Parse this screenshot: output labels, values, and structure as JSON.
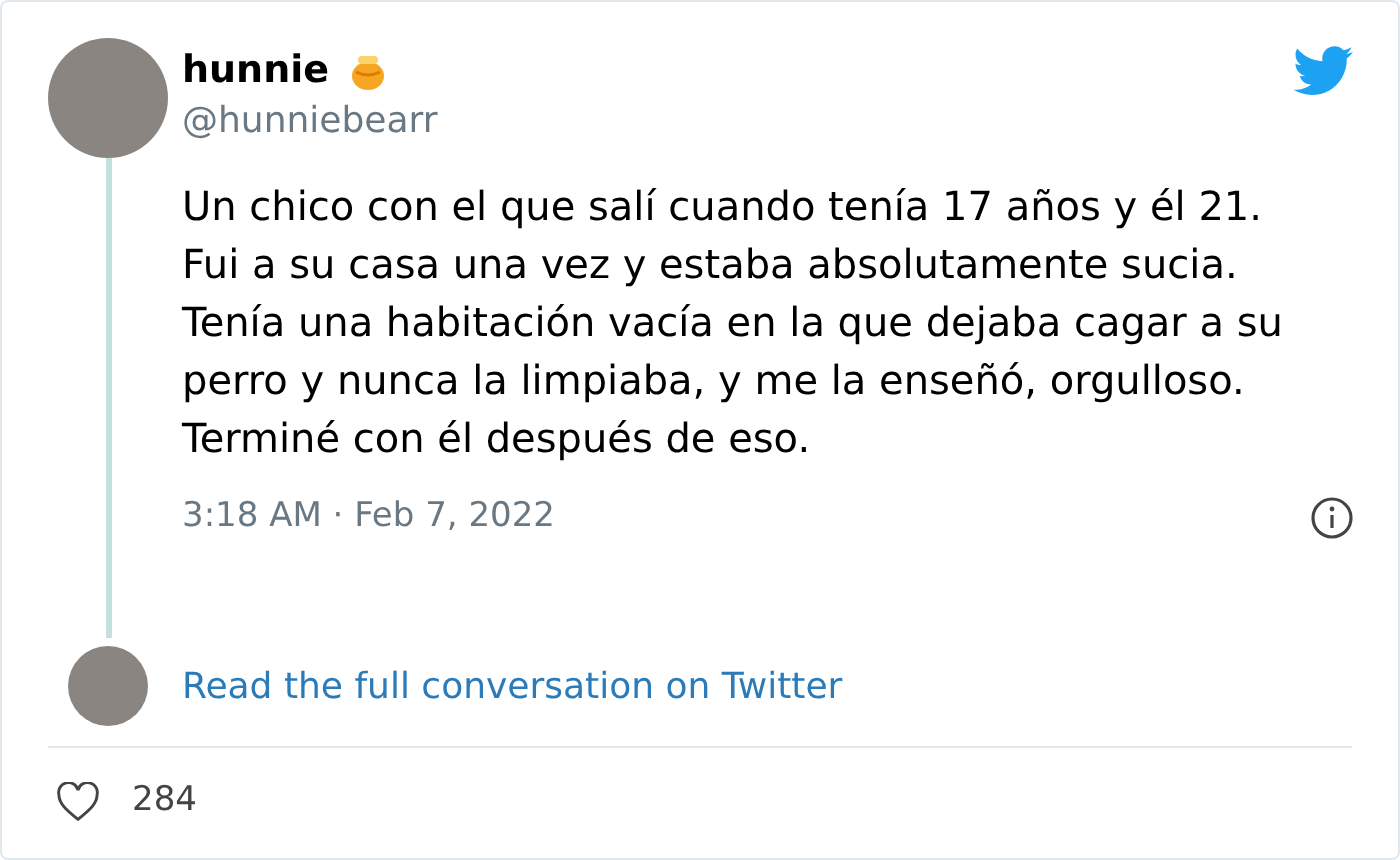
{
  "tweet": {
    "author": {
      "name": "hunnie",
      "handle": "@hunniebearr"
    },
    "text": "Un chico con el que salí cuando tenía 17 años y él 21. Fui a su casa una vez y estaba absolutamente sucia. Tenía una habitación vacía en la que dejaba cagar a su perro y nunca la limpiaba, y me la enseñó, orgulloso. Terminé con él después de eso.",
    "timestamp": "3:18 AM · Feb 7, 2022",
    "conversation_link": "Read the full conversation on Twitter",
    "likes": "284"
  }
}
